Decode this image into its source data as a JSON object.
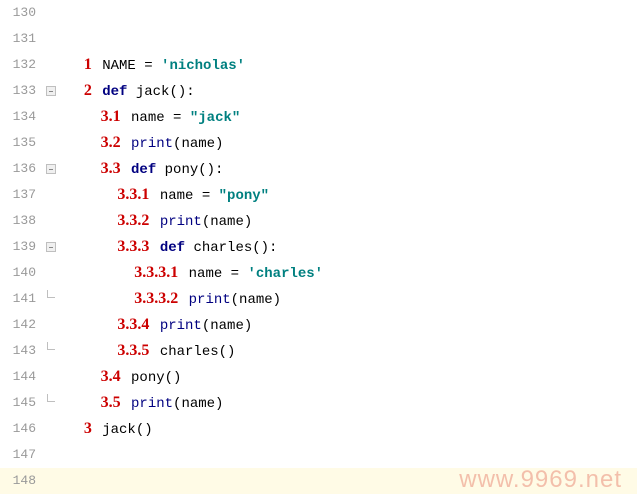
{
  "lines": [
    {
      "num": "130",
      "anno": "",
      "segments": []
    },
    {
      "num": "131",
      "anno": "",
      "segments": []
    },
    {
      "num": "132",
      "anno": "1",
      "indent": "",
      "segments": [
        {
          "t": "id",
          "v": "NAME "
        },
        {
          "t": "plain",
          "v": "= "
        },
        {
          "t": "str",
          "v": "'nicholas'"
        }
      ]
    },
    {
      "num": "133",
      "anno": "2",
      "indent": "",
      "segments": [
        {
          "t": "kw",
          "v": "def "
        },
        {
          "t": "fn",
          "v": "jack"
        },
        {
          "t": "plain",
          "v": "():"
        }
      ]
    },
    {
      "num": "134",
      "anno": "3.1",
      "indent": "  ",
      "segments": [
        {
          "t": "id",
          "v": "name "
        },
        {
          "t": "plain",
          "v": "= "
        },
        {
          "t": "str",
          "v": "\"jack\""
        }
      ]
    },
    {
      "num": "135",
      "anno": "3.2",
      "indent": "  ",
      "segments": [
        {
          "t": "builtin",
          "v": "print"
        },
        {
          "t": "plain",
          "v": "(name)"
        }
      ]
    },
    {
      "num": "136",
      "anno": "3.3",
      "indent": "  ",
      "segments": [
        {
          "t": "kw",
          "v": "def "
        },
        {
          "t": "fn",
          "v": "pony"
        },
        {
          "t": "plain",
          "v": "():"
        }
      ]
    },
    {
      "num": "137",
      "anno": "3.3.1",
      "indent": "    ",
      "segments": [
        {
          "t": "id",
          "v": "name "
        },
        {
          "t": "plain",
          "v": "= "
        },
        {
          "t": "str",
          "v": "\"pony\""
        }
      ]
    },
    {
      "num": "138",
      "anno": "3.3.2",
      "indent": "    ",
      "segments": [
        {
          "t": "builtin",
          "v": "print"
        },
        {
          "t": "plain",
          "v": "(name)"
        }
      ]
    },
    {
      "num": "139",
      "anno": "3.3.3",
      "indent": "    ",
      "segments": [
        {
          "t": "kw",
          "v": "def "
        },
        {
          "t": "fn",
          "v": "charles"
        },
        {
          "t": "plain",
          "v": "():"
        }
      ]
    },
    {
      "num": "140",
      "anno": "3.3.3.1",
      "indent": "      ",
      "segments": [
        {
          "t": "id",
          "v": "name "
        },
        {
          "t": "plain",
          "v": "= "
        },
        {
          "t": "str",
          "v": "'charles'"
        }
      ]
    },
    {
      "num": "141",
      "anno": "3.3.3.2",
      "indent": "      ",
      "segments": [
        {
          "t": "builtin",
          "v": "print"
        },
        {
          "t": "plain",
          "v": "(name)"
        }
      ]
    },
    {
      "num": "142",
      "anno": "3.3.4",
      "indent": "    ",
      "segments": [
        {
          "t": "builtin",
          "v": "print"
        },
        {
          "t": "plain",
          "v": "(name)"
        }
      ]
    },
    {
      "num": "143",
      "anno": "3.3.5",
      "indent": "    ",
      "segments": [
        {
          "t": "fn",
          "v": "charles"
        },
        {
          "t": "plain",
          "v": "()"
        }
      ]
    },
    {
      "num": "144",
      "anno": "3.4",
      "indent": "  ",
      "segments": [
        {
          "t": "fn",
          "v": "pony"
        },
        {
          "t": "plain",
          "v": "()"
        }
      ]
    },
    {
      "num": "145",
      "anno": "3.5",
      "indent": "  ",
      "segments": [
        {
          "t": "builtin",
          "v": "print"
        },
        {
          "t": "plain",
          "v": "(name)"
        }
      ]
    },
    {
      "num": "146",
      "anno": "3",
      "indent": "",
      "segments": [
        {
          "t": "fn",
          "v": "jack"
        },
        {
          "t": "plain",
          "v": "()"
        }
      ]
    },
    {
      "num": "147",
      "anno": "",
      "segments": []
    },
    {
      "num": "148",
      "anno": "",
      "segments": []
    }
  ],
  "fold": {
    "133": "open",
    "136": "open",
    "139": "open",
    "141": "close-br",
    "143": "close-br",
    "145": "close-br"
  },
  "watermark": "www.9969.net"
}
